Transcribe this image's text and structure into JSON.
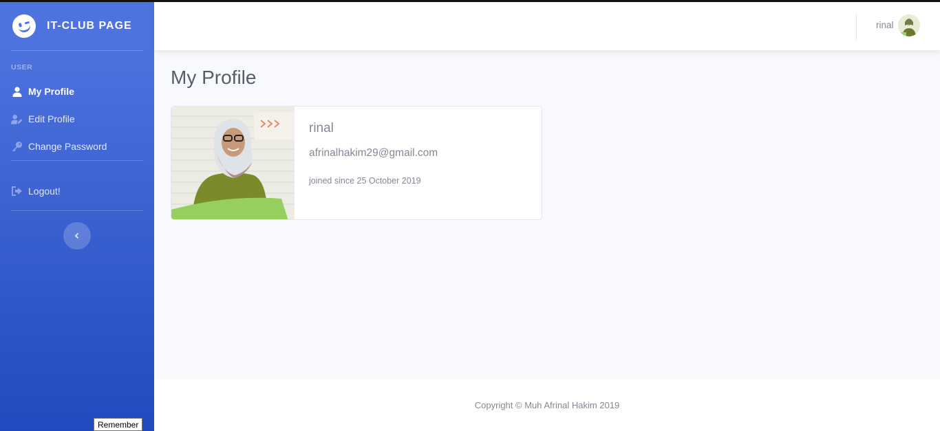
{
  "brand": {
    "title": "IT-CLUB PAGE",
    "icon": "laughing-face-icon"
  },
  "sidebar": {
    "heading": "USER",
    "items": [
      {
        "label": "My Profile",
        "icon": "user-icon",
        "active": true
      },
      {
        "label": "Edit Profile",
        "icon": "user-edit-icon",
        "active": false
      },
      {
        "label": "Change Password",
        "icon": "key-icon",
        "active": false
      },
      {
        "label": "Logout!",
        "icon": "sign-out-icon",
        "active": false
      }
    ],
    "toggle_icon": "chevron-left-icon"
  },
  "topbar": {
    "username": "rinal"
  },
  "main": {
    "title": "My Profile",
    "profile": {
      "name": "rinal",
      "email": "afrinalhakim29@gmail.com",
      "joined": "joined since 25 October 2019"
    }
  },
  "footer": {
    "copyright": "Copyright © Muh Afrinal Hakim 2019"
  },
  "tooltip": {
    "text": "Remember"
  },
  "colors": {
    "primary": "#4e73df",
    "primary_dark": "#224abe",
    "text_muted": "#858796",
    "heading": "#5a5c69",
    "background": "#f8f9fc"
  }
}
